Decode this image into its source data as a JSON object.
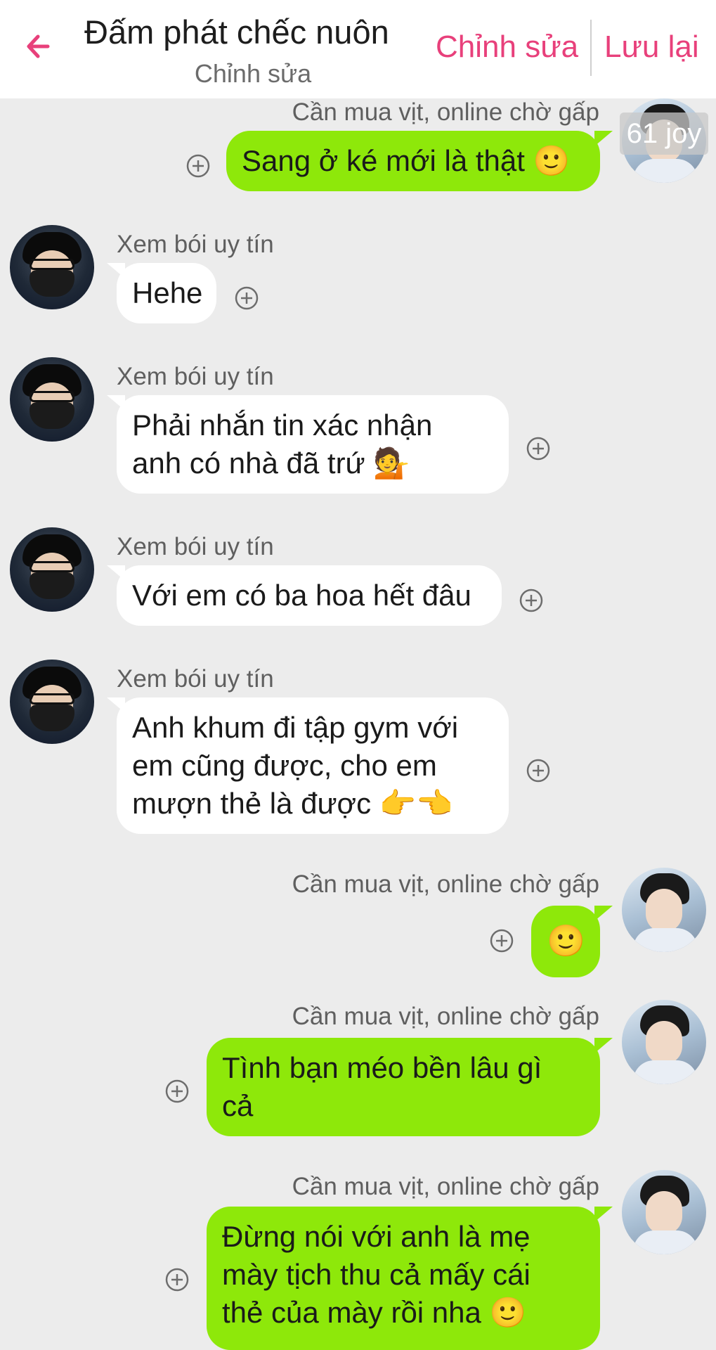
{
  "header": {
    "title": "Đấm phát chếc nuôn",
    "subtitle": "Chỉnh sửa",
    "edit_label": "Chỉnh sửa",
    "save_label": "Lưu lại",
    "accent_color": "#e8407b"
  },
  "icons": {
    "back": "back-arrow-icon",
    "add": "add-circle-icon",
    "smile": "🙂",
    "person": "💁",
    "point_right": "👉",
    "point_left": "👈"
  },
  "colors": {
    "outgoing_bubble": "#8ee80a",
    "incoming_bubble": "#ffffff",
    "background": "#ececec"
  },
  "overlay_tag": "61 joy",
  "messages": [
    {
      "side": "right",
      "sender": "Cần mua vịt, online chờ gấp",
      "lines": [
        "Sang ở ké mới là thật 🙂"
      ]
    },
    {
      "side": "left",
      "sender": "Xem bói uy tín",
      "lines": [
        "Hehe"
      ]
    },
    {
      "side": "left",
      "sender": "Xem bói uy tín",
      "lines": [
        "Phải nhắn tin xác nhận",
        "anh có nhà đã trứ 💁"
      ]
    },
    {
      "side": "left",
      "sender": "Xem bói uy tín",
      "lines": [
        "Với em có ba hoa hết đâu"
      ]
    },
    {
      "side": "left",
      "sender": "Xem bói uy tín",
      "lines": [
        "Anh khum đi tập gym với",
        "em cũng được, cho em",
        "mượn thẻ là được 👉👈"
      ]
    },
    {
      "side": "right",
      "sender": "Cần mua vịt, online chờ gấp",
      "lines": [
        "🙂"
      ]
    },
    {
      "side": "right",
      "sender": "Cần mua vịt, online chờ gấp",
      "lines": [
        "Tình bạn méo bền lâu gì",
        "cả"
      ]
    },
    {
      "side": "right",
      "sender": "Cần mua vịt, online chờ gấp",
      "lines": [
        "Đừng nói với anh là mẹ",
        "mày tịch thu cả mấy cái",
        "thẻ của mày rồi nha 🙂"
      ]
    }
  ]
}
